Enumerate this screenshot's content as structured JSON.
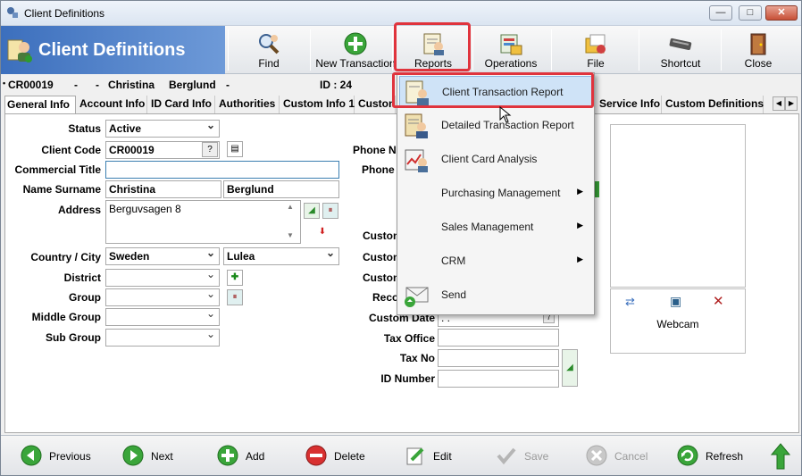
{
  "window": {
    "title": "Client Definitions",
    "minimize": "—",
    "maximize": "□",
    "close": "✕"
  },
  "toolbar": {
    "banner_title": "Client Definitions",
    "buttons": [
      {
        "label": "Find",
        "icon": "find-icon"
      },
      {
        "label": "New Transaction",
        "icon": "new-transaction-icon"
      },
      {
        "label": "Reports",
        "icon": "reports-icon"
      },
      {
        "label": "Operations",
        "icon": "operations-icon"
      },
      {
        "label": "File",
        "icon": "file-icon"
      },
      {
        "label": "Shortcut",
        "icon": "shortcut-icon"
      },
      {
        "label": "Close",
        "icon": "close-door-icon"
      }
    ]
  },
  "client_bar": {
    "code": "CR00019",
    "dash1": "-",
    "dash2": "-",
    "first_name": "Christina",
    "last_name": "Berglund",
    "dash3": "-",
    "id_label": "ID : 24"
  },
  "tabs": [
    "General Info",
    "Account Info",
    "ID Card Info",
    "Authorities",
    "Custom Info 1",
    "Custom",
    "Service Info",
    "Custom Definitions"
  ],
  "form": {
    "status_label": "Status",
    "status_value": "Active",
    "client_code_label": "Client Code",
    "client_code_value": "CR00019",
    "client_code_btn": "?",
    "commercial_title_label": "Commercial Title",
    "commercial_title_value": "",
    "name_surname_label": "Name Surname",
    "name_value": "Christina",
    "surname_value": "Berglund",
    "address_label": "Address",
    "address_value": "Berguvsagen 8",
    "country_city_label": "Country / City",
    "country_value": "Sweden",
    "city_value": "Lulea",
    "district_label": "District",
    "group_label": "Group",
    "middle_group_label": "Middle Group",
    "sub_group_label": "Sub Group",
    "phone_nu_label": "Phone Nu",
    "phone_label": "Phone",
    "custom_label_1": "Custon",
    "custom_label_2": "Custon",
    "custom_label_3": "Custon",
    "reco_label": "Reco",
    "custom_date_label": "Custom Date",
    "custom_date_value": ". .",
    "custom_date_btn": "7",
    "tax_office_label": "Tax Office",
    "tax_no_label": "Tax No",
    "id_number_label": "ID Number"
  },
  "webcam": {
    "label": "Webcam"
  },
  "reports_menu": {
    "items": [
      {
        "label": "Client Transaction Report",
        "icon": "report-person-icon",
        "submenu": false
      },
      {
        "label": "Detailed Transaction Report",
        "icon": "report-detail-icon",
        "submenu": false
      },
      {
        "label": "Client Card Analysis",
        "icon": "analysis-icon",
        "submenu": false
      },
      {
        "label": "Purchasing Management",
        "icon": "",
        "submenu": true
      },
      {
        "label": "Sales Management",
        "icon": "",
        "submenu": true
      },
      {
        "label": "CRM",
        "icon": "",
        "submenu": true
      },
      {
        "label": "Send",
        "icon": "send-mail-icon",
        "submenu": false
      }
    ]
  },
  "bottom_bar": {
    "buttons": [
      {
        "label": "Previous",
        "enabled": true
      },
      {
        "label": "Next",
        "enabled": true
      },
      {
        "label": "Add",
        "enabled": true
      },
      {
        "label": "Delete",
        "enabled": true
      },
      {
        "label": "Edit",
        "enabled": true
      },
      {
        "label": "Save",
        "enabled": false
      },
      {
        "label": "Cancel",
        "enabled": false
      },
      {
        "label": "Refresh",
        "enabled": true
      }
    ]
  },
  "colors": {
    "banner": "#3c6fbd",
    "highlight": "#e0343d",
    "menu_hover": "#cfe3f7"
  }
}
